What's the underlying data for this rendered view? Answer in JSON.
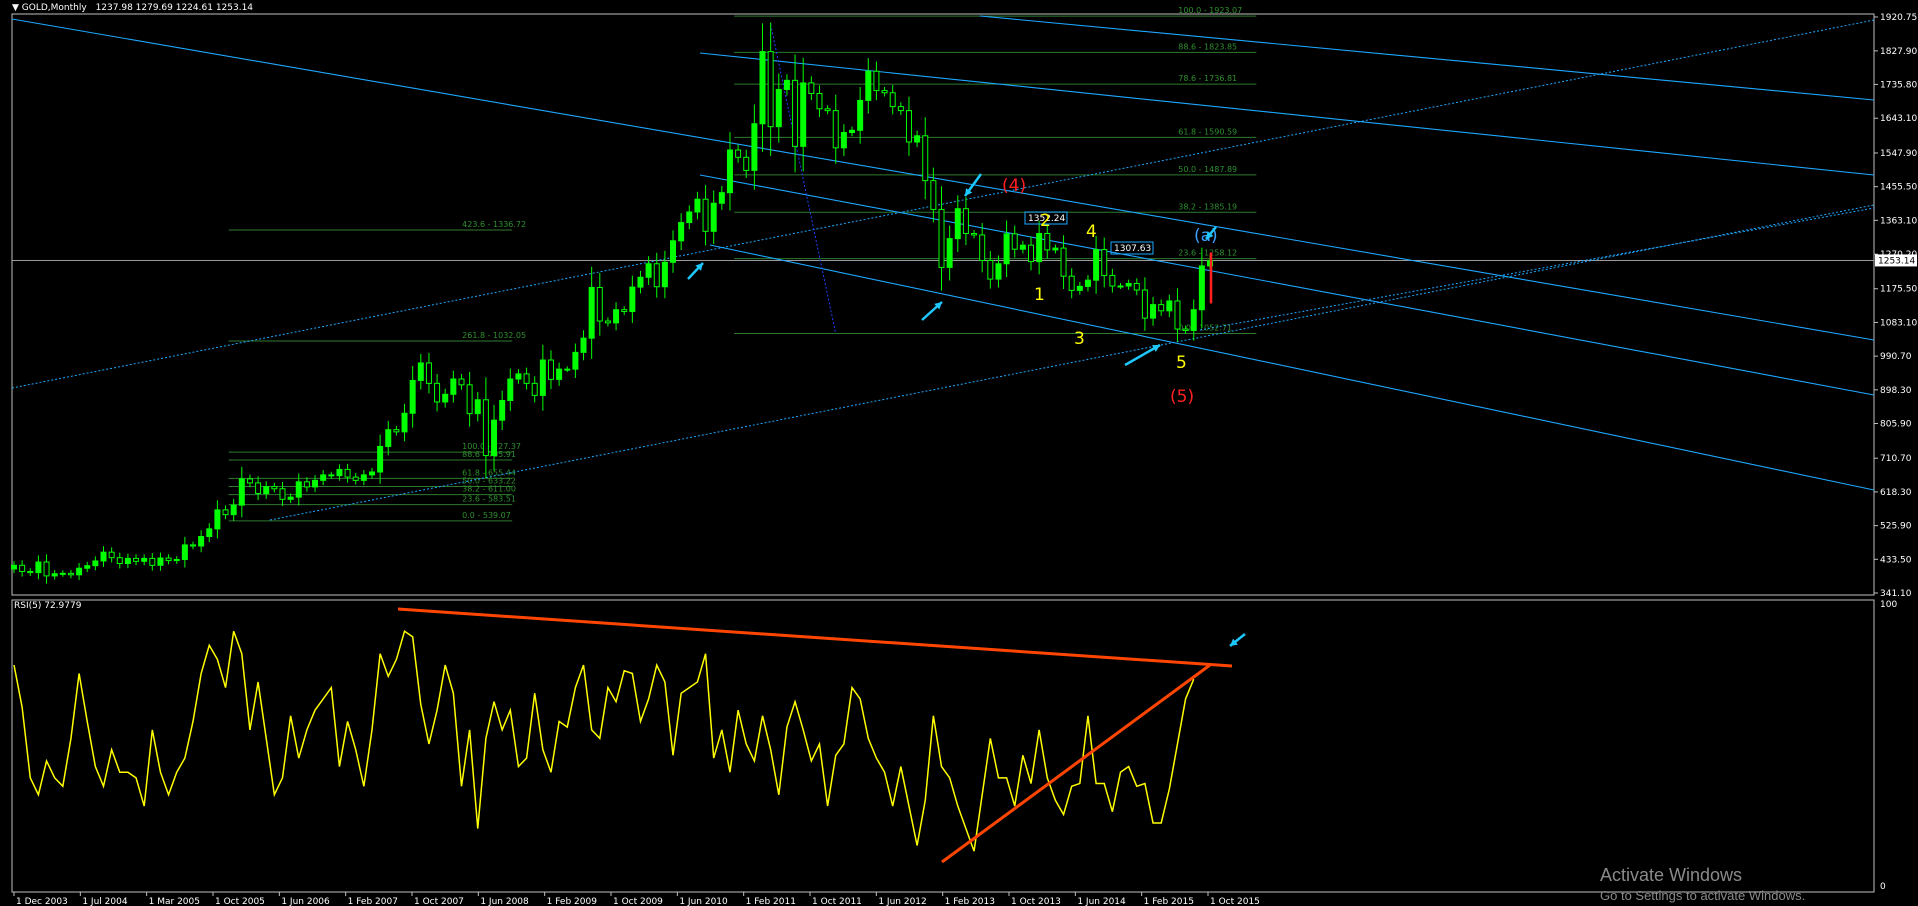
{
  "header": {
    "symbol": "GOLD,Monthly",
    "ohlc": "1237.98 1279.69 1224.61 1253.14",
    "dropdown_icon": "triangle-down-icon"
  },
  "rsi_header": "RSI(5) 72.9779",
  "watermark": {
    "title": "Activate Windows",
    "subtitle": "Go to Settings to activate Windows."
  },
  "colors": {
    "background": "#000000",
    "grid_border": "#c0c0c0",
    "bull_candle": "#00ff00",
    "bear_candle": "#000000",
    "channel_lines": "#1ea7ff",
    "fib_lines": "#2f7a2f",
    "fib_labels": "#2f8f2f",
    "rsi_line": "#ffff00",
    "trendline": "#ff4500",
    "arrows": "#1ec8ff",
    "wave_yellow": "#ffff00",
    "wave_red": "#ff2020",
    "wave_blue": "#3aa0ff"
  },
  "chart_data": [
    {
      "type": "candlestick",
      "title": "GOLD,Monthly",
      "x_tick_labels": [
        "1 Dec 2003",
        "1 Jul 2004",
        "1 Mar 2005",
        "1 Oct 2005",
        "1 Jun 2006",
        "1 Feb 2007",
        "1 Oct 2007",
        "1 Jun 2008",
        "1 Feb 2009",
        "1 Oct 2009",
        "1 Jun 2010",
        "1 Feb 2011",
        "1 Oct 2011",
        "1 Jun 2012",
        "1 Feb 2013",
        "1 Oct 2013",
        "1 Jun 2014",
        "1 Feb 2015",
        "1 Oct 2015"
      ],
      "y_tick_labels": [
        "1920.75",
        "1827.90",
        "1735.80",
        "1643.10",
        "1547.90",
        "1455.50",
        "1363.10",
        "1270.20",
        "1175.50",
        "1083.10",
        "990.70",
        "898.30",
        "805.90",
        "710.70",
        "618.30",
        "525.90",
        "433.50",
        "341.10"
      ],
      "ylim": [
        341.1,
        1920.75
      ],
      "current_price": "1253.14",
      "x_range": [
        "2003-12",
        "2016-03"
      ],
      "monthly_closes": [
        [
          "2003-12",
          417
        ],
        [
          "2004-01",
          400
        ],
        [
          "2004-02",
          397
        ],
        [
          "2004-03",
          426
        ],
        [
          "2004-04",
          388
        ],
        [
          "2004-05",
          394
        ],
        [
          "2004-06",
          395
        ],
        [
          "2004-07",
          391
        ],
        [
          "2004-08",
          409
        ],
        [
          "2004-09",
          416
        ],
        [
          "2004-10",
          429
        ],
        [
          "2004-11",
          453
        ],
        [
          "2004-12",
          438
        ],
        [
          "2005-01",
          422
        ],
        [
          "2005-02",
          436
        ],
        [
          "2005-03",
          428
        ],
        [
          "2005-04",
          436
        ],
        [
          "2005-05",
          417
        ],
        [
          "2005-06",
          437
        ],
        [
          "2005-07",
          430
        ],
        [
          "2005-08",
          433
        ],
        [
          "2005-09",
          473
        ],
        [
          "2005-10",
          470
        ],
        [
          "2005-11",
          496
        ],
        [
          "2005-12",
          517
        ],
        [
          "2006-01",
          569
        ],
        [
          "2006-02",
          556
        ],
        [
          "2006-03",
          582
        ],
        [
          "2006-04",
          654
        ],
        [
          "2006-05",
          643
        ],
        [
          "2006-06",
          614
        ],
        [
          "2006-07",
          633
        ],
        [
          "2006-08",
          627
        ],
        [
          "2006-09",
          598
        ],
        [
          "2006-10",
          604
        ],
        [
          "2006-11",
          646
        ],
        [
          "2006-12",
          632
        ],
        [
          "2007-01",
          650
        ],
        [
          "2007-02",
          665
        ],
        [
          "2007-03",
          663
        ],
        [
          "2007-04",
          680
        ],
        [
          "2007-05",
          659
        ],
        [
          "2007-06",
          650
        ],
        [
          "2007-07",
          665
        ],
        [
          "2007-08",
          673
        ],
        [
          "2007-09",
          743
        ],
        [
          "2007-10",
          789
        ],
        [
          "2007-11",
          783
        ],
        [
          "2007-12",
          834
        ],
        [
          "2008-01",
          924
        ],
        [
          "2008-02",
          972
        ],
        [
          "2008-03",
          916
        ],
        [
          "2008-04",
          865
        ],
        [
          "2008-05",
          886
        ],
        [
          "2008-06",
          928
        ],
        [
          "2008-07",
          912
        ],
        [
          "2008-08",
          833
        ],
        [
          "2008-09",
          871
        ],
        [
          "2008-10",
          718
        ],
        [
          "2008-11",
          815
        ],
        [
          "2008-12",
          869
        ],
        [
          "2009-01",
          928
        ],
        [
          "2009-02",
          942
        ],
        [
          "2009-03",
          916
        ],
        [
          "2009-04",
          883
        ],
        [
          "2009-05",
          980
        ],
        [
          "2009-06",
          927
        ],
        [
          "2009-07",
          955
        ],
        [
          "2009-08",
          955
        ],
        [
          "2009-09",
          1001
        ],
        [
          "2009-10",
          1040
        ],
        [
          "2009-11",
          1179
        ],
        [
          "2009-12",
          1087
        ],
        [
          "2010-01",
          1082
        ],
        [
          "2010-02",
          1118
        ],
        [
          "2010-03",
          1113
        ],
        [
          "2010-04",
          1180
        ],
        [
          "2010-05",
          1207
        ],
        [
          "2010-06",
          1244
        ],
        [
          "2010-07",
          1181
        ],
        [
          "2010-08",
          1248
        ],
        [
          "2010-09",
          1307
        ],
        [
          "2010-10",
          1357
        ],
        [
          "2010-11",
          1386
        ],
        [
          "2010-12",
          1421
        ],
        [
          "2011-01",
          1333
        ],
        [
          "2011-02",
          1410
        ],
        [
          "2011-03",
          1439
        ],
        [
          "2011-04",
          1556
        ],
        [
          "2011-05",
          1536
        ],
        [
          "2011-06",
          1500
        ],
        [
          "2011-07",
          1628
        ],
        [
          "2011-08",
          1826
        ],
        [
          "2011-09",
          1620
        ],
        [
          "2011-10",
          1722
        ],
        [
          "2011-11",
          1747
        ],
        [
          "2011-12",
          1566
        ],
        [
          "2012-01",
          1740
        ],
        [
          "2012-02",
          1711
        ],
        [
          "2012-03",
          1669
        ],
        [
          "2012-04",
          1664
        ],
        [
          "2012-05",
          1562
        ],
        [
          "2012-06",
          1604
        ],
        [
          "2012-07",
          1610
        ],
        [
          "2012-08",
          1692
        ],
        [
          "2012-09",
          1772
        ],
        [
          "2012-10",
          1719
        ],
        [
          "2012-11",
          1713
        ],
        [
          "2012-12",
          1675
        ],
        [
          "2013-01",
          1664
        ],
        [
          "2013-02",
          1578
        ],
        [
          "2013-03",
          1595
        ],
        [
          "2013-04",
          1472
        ],
        [
          "2013-05",
          1393
        ],
        [
          "2013-06",
          1234
        ],
        [
          "2013-07",
          1313
        ],
        [
          "2013-08",
          1395
        ],
        [
          "2013-09",
          1327
        ],
        [
          "2013-10",
          1323
        ],
        [
          "2013-11",
          1253
        ],
        [
          "2013-12",
          1202
        ],
        [
          "2014-01",
          1244
        ],
        [
          "2014-02",
          1326
        ],
        [
          "2014-03",
          1284
        ],
        [
          "2014-04",
          1295
        ],
        [
          "2014-05",
          1250
        ],
        [
          "2014-06",
          1327
        ],
        [
          "2014-07",
          1282
        ],
        [
          "2014-08",
          1287
        ],
        [
          "2014-09",
          1210
        ],
        [
          "2014-10",
          1171
        ],
        [
          "2014-11",
          1182
        ],
        [
          "2014-12",
          1199
        ],
        [
          "2015-01",
          1283
        ],
        [
          "2015-02",
          1212
        ],
        [
          "2015-03",
          1183
        ],
        [
          "2015-04",
          1183
        ],
        [
          "2015-05",
          1190
        ],
        [
          "2015-06",
          1172
        ],
        [
          "2015-07",
          1095
        ],
        [
          "2015-08",
          1132
        ],
        [
          "2015-09",
          1115
        ],
        [
          "2015-10",
          1142
        ],
        [
          "2015-11",
          1065
        ],
        [
          "2015-12",
          1061
        ],
        [
          "2016-01",
          1118
        ],
        [
          "2016-02",
          1238
        ],
        [
          "2016-03",
          1253
        ]
      ],
      "fib_levels_2011": [
        {
          "label": "100.0 - 1923.07",
          "value": 1923.07
        },
        {
          "label": "88.6 - 1823.85",
          "value": 1823.85
        },
        {
          "label": "78.6 - 1736.81",
          "value": 1736.81
        },
        {
          "label": "61.8 - 1590.59",
          "value": 1590.59
        },
        {
          "label": "50.0 - 1487.89",
          "value": 1487.89
        },
        {
          "label": "38.2 - 1385.19",
          "value": 1385.19
        },
        {
          "label": "23.6 - 1258.12",
          "value": 1258.12
        },
        {
          "label": "0.0 - 1052.71",
          "value": 1052.71
        }
      ],
      "fib_levels_2006": [
        {
          "label": "423.6 - 1336.72",
          "value": 1336.72
        },
        {
          "label": "261.8 - 1032.05",
          "value": 1032.05
        },
        {
          "label": "100.0 - 727.37",
          "value": 727.37
        },
        {
          "label": "88.6 - 705.91",
          "value": 705.91
        },
        {
          "label": "61.8 - 655.44",
          "value": 655.44
        },
        {
          "label": "50.0 - 633.22",
          "value": 633.22
        },
        {
          "label": "38.2 - 611.00",
          "value": 611.0
        },
        {
          "label": "23.6 - 583.51",
          "value": 583.51
        },
        {
          "label": "0.0 - 539.07",
          "value": 539.07
        }
      ],
      "price_boxes": [
        "1352.24",
        "1307.63"
      ],
      "wave_labels": [
        {
          "text": "(4)",
          "color": "red"
        },
        {
          "text": "2",
          "color": "yellow"
        },
        {
          "text": "4",
          "color": "yellow"
        },
        {
          "text": "1",
          "color": "yellow"
        },
        {
          "text": "3",
          "color": "yellow"
        },
        {
          "text": "5",
          "color": "yellow"
        },
        {
          "text": "(5)",
          "color": "red"
        },
        {
          "text": "(a)",
          "color": "blue"
        }
      ]
    },
    {
      "type": "line",
      "title": "RSI(5) 72.9779",
      "y_tick_labels": [
        "100",
        "0"
      ],
      "ylim": [
        0,
        100
      ],
      "series": [
        {
          "name": "RSI(5)",
          "values": [
            78,
            63,
            38,
            32,
            44,
            38,
            35,
            52,
            75,
            58,
            42,
            35,
            48,
            40,
            40,
            38,
            28,
            55,
            40,
            32,
            40,
            45,
            58,
            75,
            85,
            80,
            70,
            90,
            82,
            55,
            72,
            52,
            32,
            38,
            60,
            45,
            55,
            62,
            66,
            70,
            42,
            58,
            48,
            35,
            55,
            82,
            74,
            80,
            90,
            88,
            64,
            50,
            62,
            78,
            68,
            35,
            55,
            20,
            52,
            65,
            55,
            62,
            42,
            45,
            68,
            48,
            40,
            58,
            56,
            70,
            78,
            55,
            52,
            70,
            65,
            76,
            75,
            58,
            66,
            78,
            72,
            46,
            68,
            70,
            72,
            82,
            45,
            55,
            40,
            62,
            50,
            44,
            60,
            48,
            32,
            56,
            65,
            55,
            44,
            50,
            28,
            46,
            50,
            70,
            66,
            52,
            45,
            40,
            28,
            42,
            28,
            14,
            30,
            60,
            42,
            38,
            28,
            20,
            12,
            32,
            52,
            38,
            38,
            28,
            46,
            36,
            55,
            38,
            30,
            25,
            35,
            36,
            60,
            36,
            36,
            26,
            40,
            42,
            35,
            36,
            22,
            22,
            34,
            50,
            66,
            72.98
          ]
        }
      ],
      "current_value": "72.9779"
    }
  ]
}
